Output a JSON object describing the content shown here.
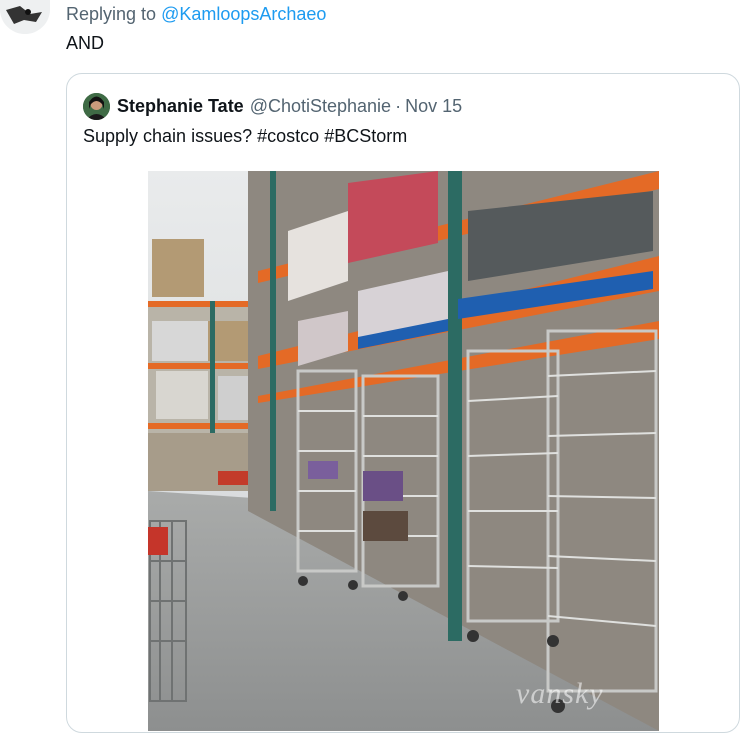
{
  "reply": {
    "prefix": "Replying to",
    "mention": "@KamloopsArchaeo"
  },
  "tweet": {
    "text": "AND"
  },
  "quote": {
    "author_name": "Stephanie Tate",
    "author_handle": "@ChotiStephanie",
    "separator": "·",
    "date": "Nov 15",
    "text_prefix": "Supply chain issues?",
    "hashtag1": "#costco",
    "hashtag2": "#BCStorm",
    "photo": {
      "subject": "warehouse aisle with empty bread racks",
      "watermark": "vansky"
    }
  },
  "colors": {
    "link": "#1d9bf0",
    "muted": "#536471",
    "text": "#0f1419",
    "border": "#cfd9de",
    "rack_orange": "#e46a26",
    "rack_teal": "#2c6b63"
  }
}
